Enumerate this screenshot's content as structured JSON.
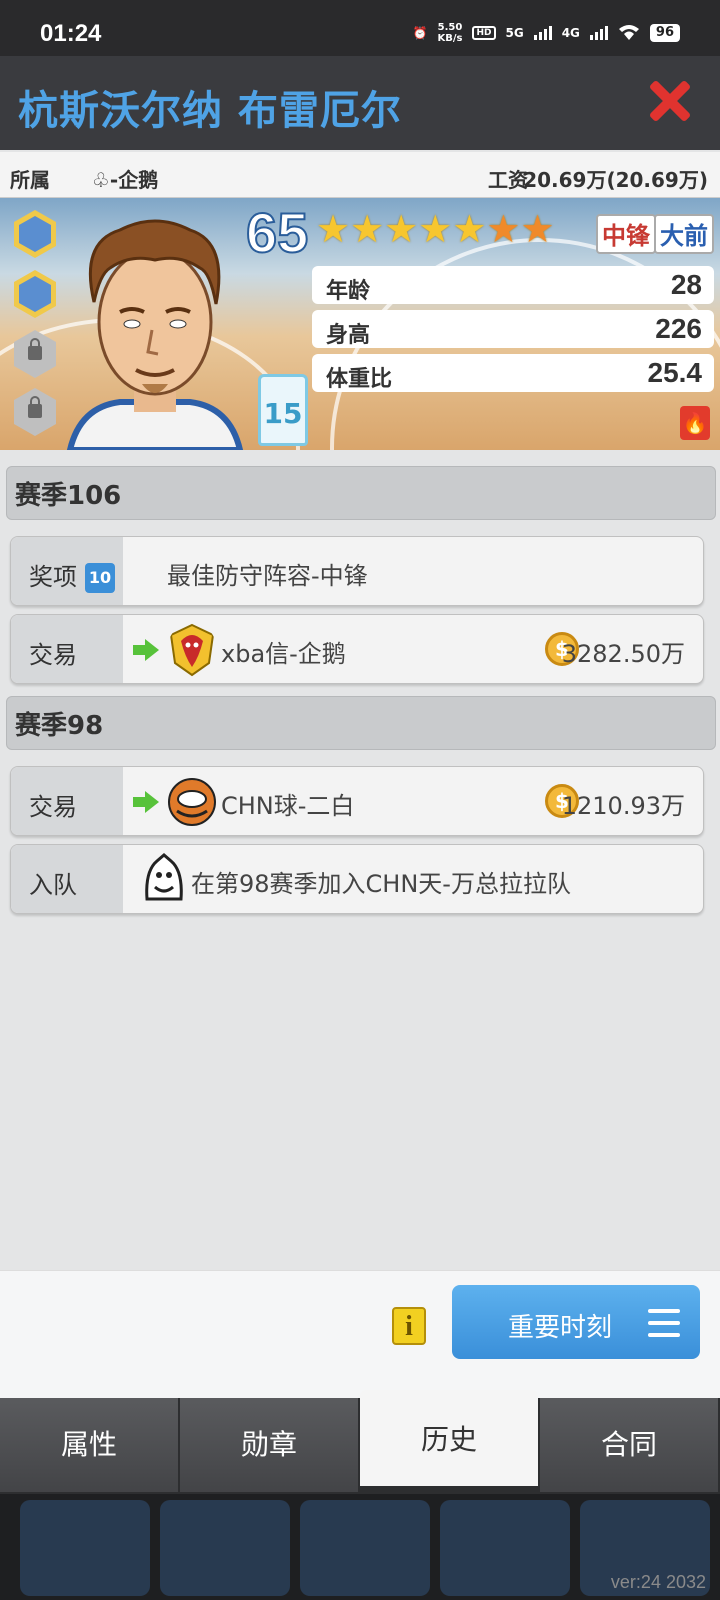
{
  "status": {
    "time": "01:24",
    "net_speed": "5.50",
    "net_unit": "KB/s",
    "hd": "HD",
    "sim1": "5G",
    "sim2": "4G",
    "battery": "96"
  },
  "header": {
    "title": "杭斯沃尔纳 布雷厄尔"
  },
  "info": {
    "team_label": "所属",
    "team": "♧-企鹅",
    "salary_label": "工资",
    "salary": "20.69万(20.69万)"
  },
  "player": {
    "rating": "65",
    "stars": {
      "filled": 5,
      "orange": 2
    },
    "positions": [
      "中锋",
      "大前"
    ],
    "jersey_number": "15",
    "stats": [
      {
        "label": "年龄",
        "value": "28"
      },
      {
        "label": "身高",
        "value": "226"
      },
      {
        "label": "体重比",
        "value": "25.4"
      }
    ]
  },
  "history": [
    {
      "season": "赛季106",
      "entries": [
        {
          "kind": "奖项",
          "badge": "10",
          "text": "最佳防守阵容-中锋"
        },
        {
          "kind": "交易",
          "text": "xba信-企鹅",
          "amount": "3282.50万"
        }
      ]
    },
    {
      "season": "赛季98",
      "entries": [
        {
          "kind": "交易",
          "text": "CHN球-二白",
          "amount": "1210.93万"
        },
        {
          "kind": "入队",
          "text": "在第98赛季加入CHN天-万总拉拉队"
        }
      ]
    }
  ],
  "actions": {
    "moments_label": "重要时刻"
  },
  "tabs": [
    "属性",
    "勋章",
    "历史",
    "合同"
  ],
  "active_tab": "历史",
  "footer": {
    "version": "ver:24  2032"
  },
  "colors": {
    "title": "#4fa3e6",
    "close": "#e0332f",
    "accent_button": "#3a8fd9"
  }
}
